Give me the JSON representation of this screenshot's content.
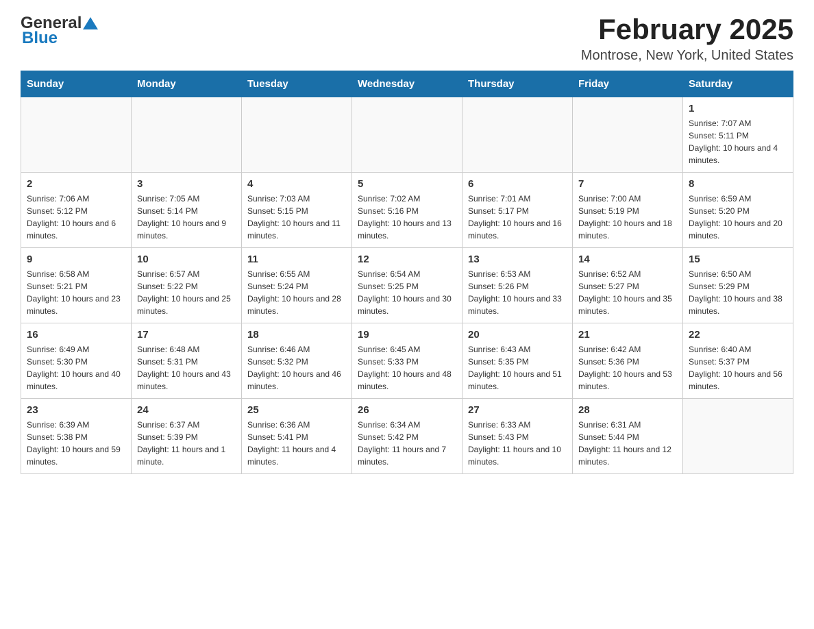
{
  "header": {
    "logo": {
      "general": "General",
      "blue": "Blue"
    },
    "title": "February 2025",
    "location": "Montrose, New York, United States"
  },
  "days_of_week": [
    "Sunday",
    "Monday",
    "Tuesday",
    "Wednesday",
    "Thursday",
    "Friday",
    "Saturday"
  ],
  "weeks": [
    [
      {
        "day": "",
        "info": ""
      },
      {
        "day": "",
        "info": ""
      },
      {
        "day": "",
        "info": ""
      },
      {
        "day": "",
        "info": ""
      },
      {
        "day": "",
        "info": ""
      },
      {
        "day": "",
        "info": ""
      },
      {
        "day": "1",
        "info": "Sunrise: 7:07 AM\nSunset: 5:11 PM\nDaylight: 10 hours and 4 minutes."
      }
    ],
    [
      {
        "day": "2",
        "info": "Sunrise: 7:06 AM\nSunset: 5:12 PM\nDaylight: 10 hours and 6 minutes."
      },
      {
        "day": "3",
        "info": "Sunrise: 7:05 AM\nSunset: 5:14 PM\nDaylight: 10 hours and 9 minutes."
      },
      {
        "day": "4",
        "info": "Sunrise: 7:03 AM\nSunset: 5:15 PM\nDaylight: 10 hours and 11 minutes."
      },
      {
        "day": "5",
        "info": "Sunrise: 7:02 AM\nSunset: 5:16 PM\nDaylight: 10 hours and 13 minutes."
      },
      {
        "day": "6",
        "info": "Sunrise: 7:01 AM\nSunset: 5:17 PM\nDaylight: 10 hours and 16 minutes."
      },
      {
        "day": "7",
        "info": "Sunrise: 7:00 AM\nSunset: 5:19 PM\nDaylight: 10 hours and 18 minutes."
      },
      {
        "day": "8",
        "info": "Sunrise: 6:59 AM\nSunset: 5:20 PM\nDaylight: 10 hours and 20 minutes."
      }
    ],
    [
      {
        "day": "9",
        "info": "Sunrise: 6:58 AM\nSunset: 5:21 PM\nDaylight: 10 hours and 23 minutes."
      },
      {
        "day": "10",
        "info": "Sunrise: 6:57 AM\nSunset: 5:22 PM\nDaylight: 10 hours and 25 minutes."
      },
      {
        "day": "11",
        "info": "Sunrise: 6:55 AM\nSunset: 5:24 PM\nDaylight: 10 hours and 28 minutes."
      },
      {
        "day": "12",
        "info": "Sunrise: 6:54 AM\nSunset: 5:25 PM\nDaylight: 10 hours and 30 minutes."
      },
      {
        "day": "13",
        "info": "Sunrise: 6:53 AM\nSunset: 5:26 PM\nDaylight: 10 hours and 33 minutes."
      },
      {
        "day": "14",
        "info": "Sunrise: 6:52 AM\nSunset: 5:27 PM\nDaylight: 10 hours and 35 minutes."
      },
      {
        "day": "15",
        "info": "Sunrise: 6:50 AM\nSunset: 5:29 PM\nDaylight: 10 hours and 38 minutes."
      }
    ],
    [
      {
        "day": "16",
        "info": "Sunrise: 6:49 AM\nSunset: 5:30 PM\nDaylight: 10 hours and 40 minutes."
      },
      {
        "day": "17",
        "info": "Sunrise: 6:48 AM\nSunset: 5:31 PM\nDaylight: 10 hours and 43 minutes."
      },
      {
        "day": "18",
        "info": "Sunrise: 6:46 AM\nSunset: 5:32 PM\nDaylight: 10 hours and 46 minutes."
      },
      {
        "day": "19",
        "info": "Sunrise: 6:45 AM\nSunset: 5:33 PM\nDaylight: 10 hours and 48 minutes."
      },
      {
        "day": "20",
        "info": "Sunrise: 6:43 AM\nSunset: 5:35 PM\nDaylight: 10 hours and 51 minutes."
      },
      {
        "day": "21",
        "info": "Sunrise: 6:42 AM\nSunset: 5:36 PM\nDaylight: 10 hours and 53 minutes."
      },
      {
        "day": "22",
        "info": "Sunrise: 6:40 AM\nSunset: 5:37 PM\nDaylight: 10 hours and 56 minutes."
      }
    ],
    [
      {
        "day": "23",
        "info": "Sunrise: 6:39 AM\nSunset: 5:38 PM\nDaylight: 10 hours and 59 minutes."
      },
      {
        "day": "24",
        "info": "Sunrise: 6:37 AM\nSunset: 5:39 PM\nDaylight: 11 hours and 1 minute."
      },
      {
        "day": "25",
        "info": "Sunrise: 6:36 AM\nSunset: 5:41 PM\nDaylight: 11 hours and 4 minutes."
      },
      {
        "day": "26",
        "info": "Sunrise: 6:34 AM\nSunset: 5:42 PM\nDaylight: 11 hours and 7 minutes."
      },
      {
        "day": "27",
        "info": "Sunrise: 6:33 AM\nSunset: 5:43 PM\nDaylight: 11 hours and 10 minutes."
      },
      {
        "day": "28",
        "info": "Sunrise: 6:31 AM\nSunset: 5:44 PM\nDaylight: 11 hours and 12 minutes."
      },
      {
        "day": "",
        "info": ""
      }
    ]
  ]
}
